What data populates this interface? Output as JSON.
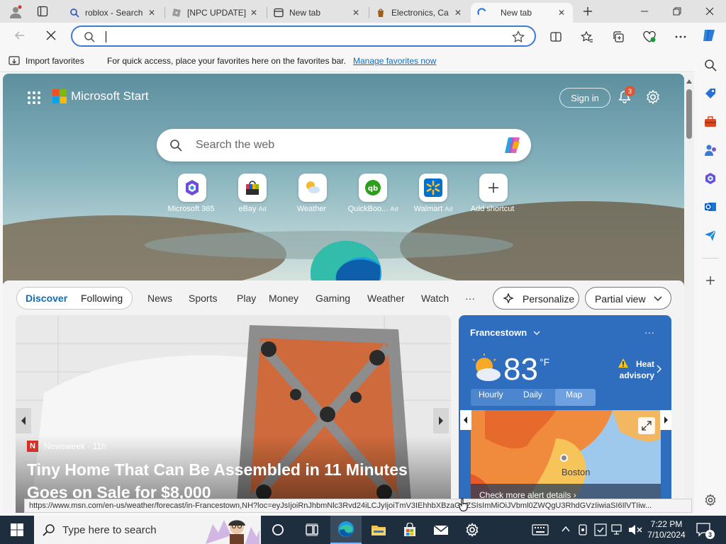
{
  "browser": {
    "tabs": [
      {
        "title": "roblox - Search",
        "icon": "search-icon"
      },
      {
        "title": "[NPC UPDATE]",
        "icon": "roblox-icon"
      },
      {
        "title": "New tab",
        "icon": "newtab-icon"
      },
      {
        "title": "Electronics, Ca",
        "icon": "store-icon"
      },
      {
        "title": "New tab",
        "icon": "edge-loading-icon",
        "active": true
      }
    ],
    "address_value": "",
    "favorites": {
      "import_label": "Import favorites",
      "hint": "For quick access, place your favorites here on the favorites bar.",
      "manage_link": "Manage favorites now"
    },
    "status_url": "https://www.msn.com/en-us/weather/forecast/in-Francestown,NH?loc=eyJsIjoiRnJhbmNlc3Rvd24iLCJyIjoiTmV3IEhhbXBzaGlyZSIsImMiOiJVbml0ZWQgU3RhdGVzIiwiaSI6IlVTIiw..."
  },
  "page": {
    "brand": "Microsoft Start",
    "sign_in": "Sign in",
    "notification_count": "3",
    "search_placeholder": "Search the web",
    "shortcuts": [
      {
        "label": "Microsoft 365",
        "ad": ""
      },
      {
        "label": "eBay",
        "ad": "Ad"
      },
      {
        "label": "Weather",
        "ad": ""
      },
      {
        "label": "QuickBoo...",
        "ad": "Ad"
      },
      {
        "label": "Walmart",
        "ad": "Ad"
      },
      {
        "label": "Add shortcut",
        "ad": ""
      }
    ],
    "nav_tabs": [
      "Discover",
      "Following",
      "News",
      "Sports",
      "Play",
      "Money",
      "Gaming",
      "Weather",
      "Watch"
    ],
    "more_label": "···",
    "personalize": "Personalize",
    "view_mode": "Partial view",
    "hero": {
      "source": "Newsweek",
      "age": "11h",
      "headline": "Tiny Home That Can Be Assembled in 11 Minutes Goes on Sale for $8,000"
    },
    "weather": {
      "location": "Francestown",
      "temp": "83",
      "unit": "°F",
      "alert": "Heat advisory",
      "tabs": [
        "Hourly",
        "Daily",
        "Map"
      ],
      "selected_tab": "Map",
      "map_city": "Boston",
      "cta": "Check more alert details"
    }
  },
  "taskbar": {
    "search_placeholder": "Type here to search",
    "time": "7:22 PM",
    "date": "7/10/2024",
    "notification_count": "3"
  },
  "colors": {
    "accent": "#0f6cbd",
    "weather_card": "#2f6dbf",
    "taskbar": "#1f2e3e"
  }
}
